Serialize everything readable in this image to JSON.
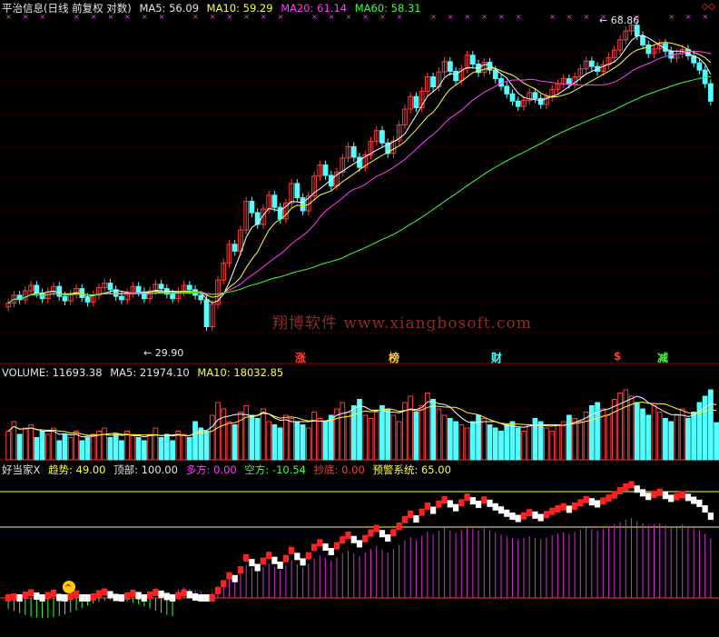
{
  "header_main": {
    "title": "平治信息(日线 前复权 对数)",
    "ma5": "MA5: 56.09",
    "ma10": "MA10: 59.29",
    "ma20": "MA20: 61.14",
    "ma60": "MA60: 58.31"
  },
  "header_volume": {
    "volume": "VOLUME: 11693.38",
    "ma5": "MA5: 21974.10",
    "ma10": "MA10: 18032.85"
  },
  "header_indicator": {
    "name": "好当家X",
    "trend": "趋势: 49.00",
    "top": "顶部: 100.00",
    "long": "多方: 0.00",
    "short": "空方: -10.54",
    "bottom": "抄底: 0.00",
    "warning": "预警系统: 65.00"
  },
  "annotations": {
    "high": "68.86",
    "low": "29.90",
    "watermark": "翔博软件 www.xiangbosoft.com",
    "tags": [
      "涨",
      "榜",
      "财",
      "$",
      "减"
    ]
  },
  "colors": {
    "up": "#ff3c3c",
    "down": "#54ffff",
    "ma5": "#ffffff",
    "ma10": "#ffff3c",
    "ma20": "#ff3cff",
    "ma60": "#3cff3c",
    "grid": "#a00000"
  },
  "chart_data": [
    {
      "type": "candlestick",
      "title": "平治信息(日线 前复权 对数)",
      "y_scale": "log",
      "high": 68.86,
      "low": 29.9,
      "closes": [
        32.5,
        33.2,
        32.8,
        33.6,
        34.1,
        33.4,
        32.9,
        33.5,
        34.0,
        33.1,
        32.7,
        33.3,
        33.8,
        33.0,
        32.6,
        33.2,
        33.9,
        34.3,
        33.7,
        33.1,
        32.8,
        33.4,
        34.0,
        33.5,
        32.9,
        33.6,
        34.2,
        33.8,
        33.3,
        32.9,
        33.5,
        34.1,
        33.7,
        33.2,
        32.8,
        30.5,
        32.4,
        34.6,
        36.2,
        38.1,
        37.4,
        39.6,
        42.8,
        41.5,
        40.2,
        41.9,
        43.5,
        42.1,
        40.8,
        42.6,
        44.9,
        43.2,
        41.7,
        43.4,
        45.8,
        47.2,
        45.9,
        44.6,
        46.3,
        48.1,
        49.6,
        48.2,
        46.9,
        48.5,
        50.3,
        51.8,
        50.1,
        48.7,
        50.4,
        52.6,
        54.9,
        56.8,
        55.1,
        57.6,
        59.9,
        58.3,
        60.7,
        62.4,
        60.8,
        59.3,
        61.2,
        63.5,
        62.0,
        60.6,
        62.3,
        61.0,
        59.6,
        58.4,
        57.2,
        56.1,
        55.3,
        56.2,
        57.4,
        56.5,
        55.6,
        56.7,
        57.9,
        58.8,
        59.6,
        58.7,
        59.9,
        61.2,
        62.5,
        61.6,
        60.8,
        61.9,
        63.1,
        64.4,
        66.2,
        67.8,
        68.86,
        66.9,
        65.3,
        63.8,
        64.6,
        65.5,
        64.2,
        63.0,
        63.7,
        64.5,
        63.4,
        62.2,
        61.0,
        58.8,
        56.09
      ],
      "ma_values": {
        "MA5": 56.09,
        "MA10": 59.29,
        "MA20": 61.14,
        "MA60": 58.31
      }
    },
    {
      "type": "bar",
      "title": "VOLUME",
      "values": [
        9,
        12,
        8,
        10,
        11,
        7,
        9,
        8,
        10,
        6,
        8,
        7,
        9,
        6,
        7,
        8,
        9,
        10,
        7,
        8,
        6,
        9,
        8,
        7,
        6,
        8,
        10,
        7,
        8,
        6,
        9,
        8,
        7,
        12,
        10,
        9,
        14,
        18,
        16,
        12,
        11,
        15,
        17,
        14,
        13,
        16,
        12,
        11,
        10,
        14,
        13,
        12,
        11,
        10,
        15,
        13,
        12,
        14,
        16,
        18,
        15,
        17,
        19,
        14,
        13,
        15,
        17,
        16,
        14,
        12,
        18,
        20,
        15,
        17,
        21,
        19,
        16,
        14,
        13,
        12,
        11,
        10,
        12,
        14,
        13,
        11,
        10,
        9,
        11,
        12,
        10,
        9,
        11,
        13,
        12,
        10,
        9,
        11,
        12,
        14,
        13,
        12,
        15,
        17,
        18,
        16,
        14,
        19,
        21,
        22,
        20,
        18,
        16,
        14,
        17,
        15,
        13,
        12,
        14,
        16,
        13,
        15,
        18,
        20,
        22,
        11.69
      ],
      "ma_values": {
        "MA5": 21974.1,
        "MA10": 18032.85
      },
      "current": 11693.38
    },
    {
      "type": "line",
      "title": "好当家X",
      "values": {
        "趋势": 49.0,
        "顶部": 100.0,
        "多方": 0.0,
        "空方": -10.54,
        "抄底": 0.0,
        "预警系统": 65.0
      }
    }
  ]
}
